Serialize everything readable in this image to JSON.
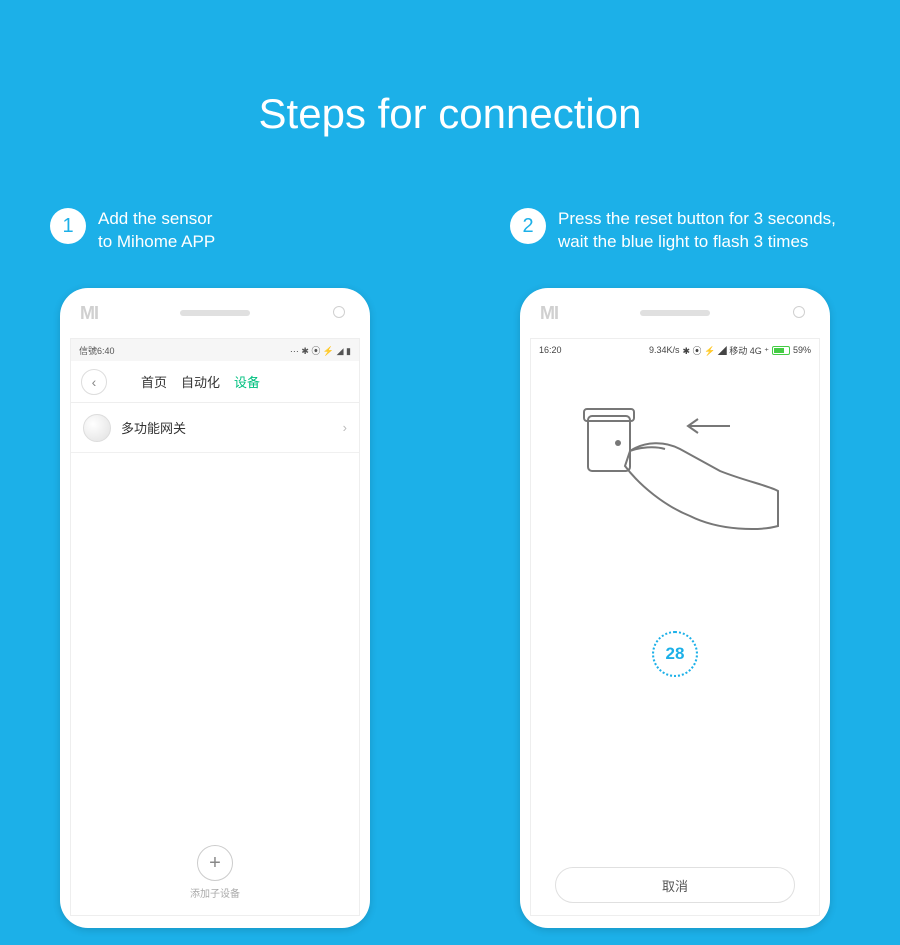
{
  "title": "Steps for connection",
  "steps": [
    {
      "num": "1",
      "text": "Add the sensor\nto Mihome APP"
    },
    {
      "num": "2",
      "text": "Press the reset button for 3 seconds,\nwait the blue light to flash 3 times"
    }
  ],
  "phone1": {
    "status": {
      "left": "信號6:40",
      "right_icons": "⋯ ✱ ⦿ ⚡ ◢ ▮"
    },
    "tabs": {
      "home": "首页",
      "auto": "自动化",
      "device": "设备"
    },
    "list_item": "多功能网关",
    "add_label": "添加子设备"
  },
  "phone2": {
    "status": {
      "left": "16:20",
      "speed": "9.34K/s",
      "right": "✱ ⦿ ⚡ ◢ 移动 4G ⁺",
      "batt": "59%"
    },
    "countdown": "28",
    "cancel": "取消"
  }
}
